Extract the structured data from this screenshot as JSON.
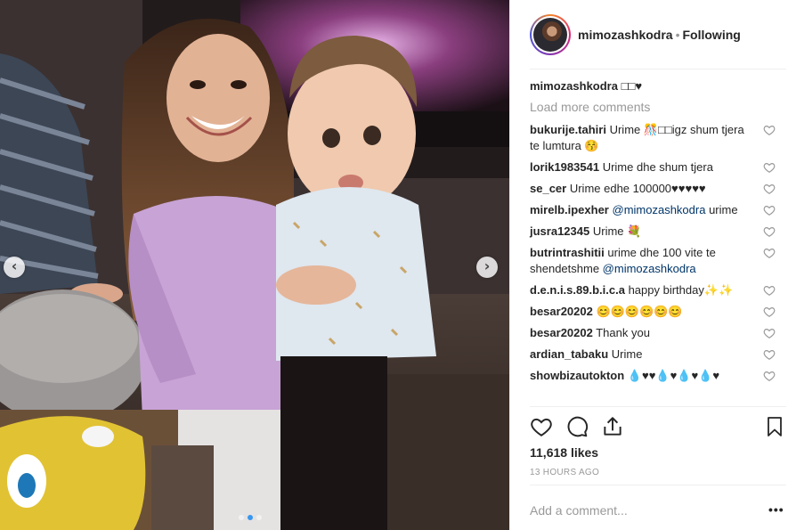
{
  "post": {
    "username": "mimozashkodra",
    "separator": "•",
    "follow_status": "Following",
    "caption_text": "□□♥",
    "load_more": "Load more comments",
    "likes": "11,618 likes",
    "time": "13 HOURS AGO",
    "add_comment_placeholder": "Add a comment...",
    "more_label": "•••"
  },
  "comments": [
    {
      "user": "bukurije.tahiri",
      "text": "Urime 🎊□□igz shum tjera te lumtura 😚"
    },
    {
      "user": "lorik1983541",
      "text": "Urime dhe shum tjera"
    },
    {
      "user": "se_cer",
      "text": "Urime edhe 100000♥♥♥♥♥"
    },
    {
      "user": "mirelb.ipexher",
      "text": "",
      "mention": "@mimozashkodra",
      "after": " urime"
    },
    {
      "user": "jusra12345",
      "text": "Urime 💐"
    },
    {
      "user": "butrintrashitii",
      "text": "urime dhe 100 vite te shendetshme ",
      "mention": "@mimozashkodra"
    },
    {
      "user": "d.e.n.i.s.89.b.i.c.a",
      "text": "happy birthday✨✨"
    },
    {
      "user": "besar20202",
      "text": "😊😊😊😊😊😊"
    },
    {
      "user": "besar20202",
      "text": "Thank you"
    },
    {
      "user": "ardian_tabaku",
      "text": "Urime"
    },
    {
      "user": "showbizautokton",
      "text": "💧♥♥💧♥💧♥💧♥"
    }
  ],
  "icons": {
    "like": "heart-outline-icon",
    "comment": "comment-bubble-icon",
    "share": "share-icon",
    "save": "bookmark-icon",
    "prev": "chevron-left-icon",
    "next": "chevron-right-icon"
  },
  "carousel": {
    "count": 3,
    "active_index": 1
  },
  "colors": {
    "link": "#003569",
    "muted": "#999999",
    "active_dot": "#3897f0",
    "text": "#262626"
  }
}
